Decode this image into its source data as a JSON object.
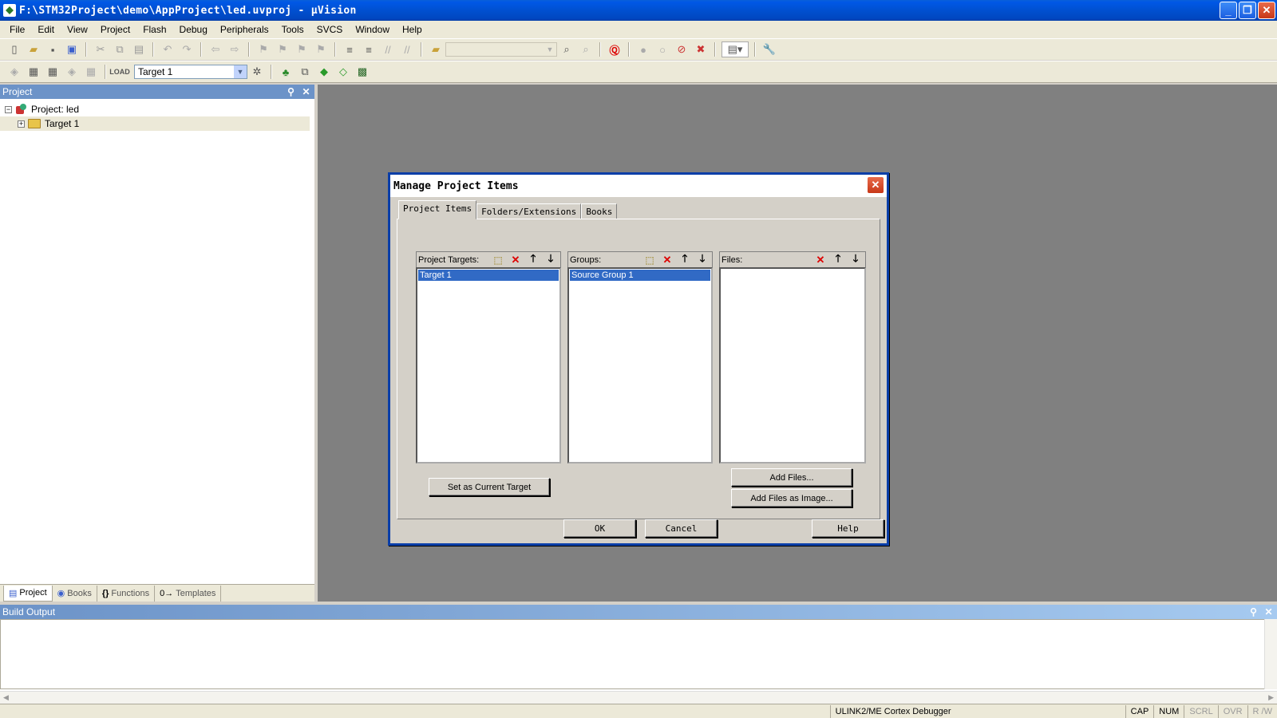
{
  "window": {
    "title": "F:\\STM32Project\\demo\\AppProject\\led.uvproj - µVision",
    "minimize": "_",
    "maximize": "❐",
    "close": "✕"
  },
  "menu": [
    "File",
    "Edit",
    "View",
    "Project",
    "Flash",
    "Debug",
    "Peripherals",
    "Tools",
    "SVCS",
    "Window",
    "Help"
  ],
  "toolbar": {
    "target_combo": "Target 1",
    "find_combo": ""
  },
  "project_pane": {
    "title": "Project",
    "tree": {
      "root": "Project: led",
      "child": "Target 1",
      "root_expander": "−",
      "child_expander": "+"
    },
    "tabs": [
      {
        "label": "Project",
        "icon": "▤"
      },
      {
        "label": "Books",
        "icon": "◉"
      },
      {
        "label": "Functions",
        "icon": "{}"
      },
      {
        "label": "Templates",
        "icon": "0→"
      }
    ]
  },
  "build_pane": {
    "title": "Build Output"
  },
  "status": {
    "debugger": "ULINK2/ME Cortex Debugger",
    "cap": "CAP",
    "num": "NUM",
    "scrl": "SCRL",
    "ovr": "OVR",
    "rw": "R /W"
  },
  "dialog": {
    "title": "Manage Project Items",
    "close": "✕",
    "tabs": [
      "Project Items",
      "Folders/Extensions",
      "Books"
    ],
    "targets": {
      "label": "Project Targets:",
      "items": [
        "Target 1"
      ]
    },
    "groups": {
      "label": "Groups:",
      "items": [
        "Source Group 1"
      ]
    },
    "files": {
      "label": "Files:",
      "items": []
    },
    "icons": {
      "new": "⬚",
      "delete": "✕",
      "up": "🡑",
      "down": "🡓"
    },
    "buttons": {
      "set_current": "Set as Current Target",
      "add_files": "Add Files...",
      "add_files_image": "Add Files as Image...",
      "ok": "OK",
      "cancel": "Cancel",
      "help": "Help"
    }
  }
}
